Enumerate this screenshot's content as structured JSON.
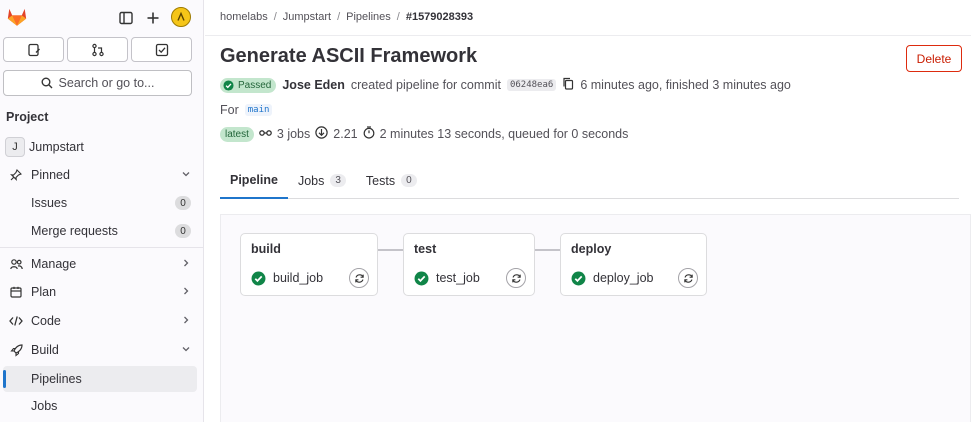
{
  "sidebar": {
    "section_title": "Project",
    "search_placeholder": "Search or go to...",
    "items": [
      {
        "label": "Jumpstart",
        "avatar_letter": "J"
      },
      {
        "label": "Pinned"
      },
      {
        "label": "Issues",
        "count": "0"
      },
      {
        "label": "Merge requests",
        "count": "0"
      },
      {
        "label": "Manage"
      },
      {
        "label": "Plan"
      },
      {
        "label": "Code"
      },
      {
        "label": "Build"
      },
      {
        "label": "Pipelines"
      },
      {
        "label": "Jobs"
      }
    ]
  },
  "breadcrumb": {
    "items": [
      "homelabs",
      "Jumpstart",
      "Pipelines",
      "#1579028393"
    ],
    "sep": "/"
  },
  "pipeline": {
    "title": "Generate ASCII Framework",
    "delete_label": "Delete",
    "status": "Passed",
    "author": "Jose Eden",
    "created_text": "created pipeline for commit",
    "commit": "06248ea6",
    "timing": "6 minutes ago, finished 3 minutes ago",
    "for_text": "For",
    "ref": "main",
    "latest_badge": "latest",
    "jobs_count": "3 jobs",
    "version": "2.21",
    "duration": "2 minutes 13 seconds, queued for 0 seconds"
  },
  "tabs": [
    {
      "label": "Pipeline"
    },
    {
      "label": "Jobs",
      "count": "3"
    },
    {
      "label": "Tests",
      "count": "0"
    }
  ],
  "stages": [
    {
      "name": "build",
      "job": "build_job"
    },
    {
      "name": "test",
      "job": "test_job"
    },
    {
      "name": "deploy",
      "job": "deploy_job"
    }
  ],
  "colors": {
    "accent": "#1f75cb",
    "success": "#108548",
    "danger": "#dd2b0e",
    "logo": "#e24329"
  }
}
